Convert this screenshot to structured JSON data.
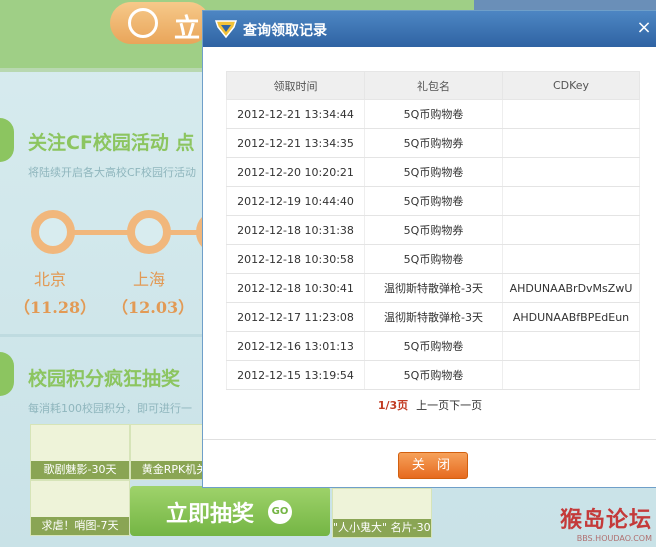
{
  "background": {
    "top_button_label": "立",
    "section1": {
      "title": "关注CF校园活动 点",
      "subtitle": "将陆续开启各大高校CF校园行活动"
    },
    "timeline": [
      {
        "city": "北京",
        "date": "（11.28）"
      },
      {
        "city": "上海",
        "date": "（12.03）"
      }
    ],
    "section2": {
      "title": "校园积分疯狂抽奖",
      "subtitle": "每消耗100校园积分，即可进行一"
    },
    "prizes": [
      {
        "label": "歌剧魅影-30天"
      },
      {
        "label": "黄金RPK机关枪"
      },
      {
        "label": "求虐！哨图-7天"
      },
      {
        "label": "\"人小鬼大\" 名片-30天"
      }
    ],
    "draw_button_label": "立即抽奖",
    "draw_button_go": "GO",
    "watermark": {
      "main": "猴岛论坛",
      "sub": "BBS.HOUDAO.COM"
    }
  },
  "dialog": {
    "title": "查询领取记录",
    "close_label": "×",
    "columns": [
      "领取时间",
      "礼包名",
      "CDKey"
    ],
    "rows": [
      {
        "time": "2012-12-21 13:34:44",
        "name": "5Q币购物卷",
        "cdkey": ""
      },
      {
        "time": "2012-12-21 13:34:35",
        "name": "5Q币购物券",
        "cdkey": ""
      },
      {
        "time": "2012-12-20 10:20:21",
        "name": "5Q币购物卷",
        "cdkey": ""
      },
      {
        "time": "2012-12-19 10:44:40",
        "name": "5Q币购物卷",
        "cdkey": ""
      },
      {
        "time": "2012-12-18 10:31:38",
        "name": "5Q币购物券",
        "cdkey": ""
      },
      {
        "time": "2012-12-18 10:30:58",
        "name": "5Q币购物卷",
        "cdkey": ""
      },
      {
        "time": "2012-12-18 10:30:41",
        "name": "温彻斯特散弹枪-3天",
        "cdkey": "AHDUNAABrDvMsZwU"
      },
      {
        "time": "2012-12-17 11:23:08",
        "name": "温彻斯特散弹枪-3天",
        "cdkey": "AHDUNAABfBPEdEun"
      },
      {
        "time": "2012-12-16 13:01:13",
        "name": "5Q币购物卷",
        "cdkey": ""
      },
      {
        "time": "2012-12-15 13:19:54",
        "name": "5Q币购物卷",
        "cdkey": ""
      }
    ],
    "pager": {
      "current": "1/3页",
      "prev": "上一页",
      "next": "下一页"
    },
    "close_button_label": "关 闭",
    "colors": {
      "header": "#3a72b3",
      "accent": "#c23b22",
      "button": "#ee7a2e"
    }
  }
}
